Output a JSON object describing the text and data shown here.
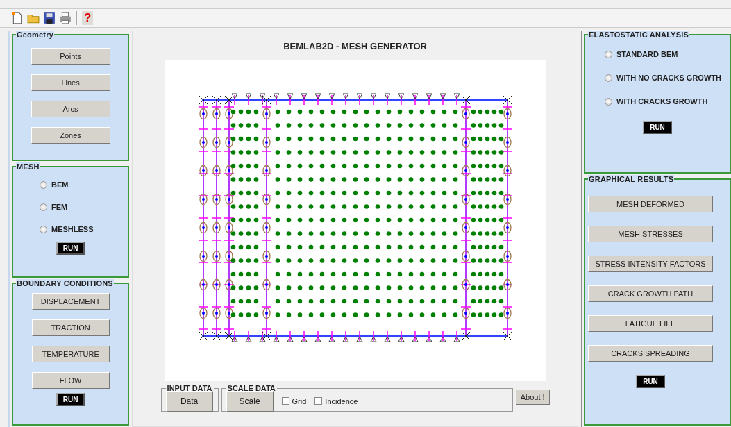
{
  "toolbar": {
    "help_label": "?"
  },
  "geometry": {
    "title": "Geometry",
    "buttons": [
      "Points",
      "Lines",
      "Arcs",
      "Zones"
    ]
  },
  "mesh": {
    "title": "MESH",
    "options": [
      {
        "label": "BEM",
        "selected": false
      },
      {
        "label": "FEM",
        "selected": false
      },
      {
        "label": "MESHLESS",
        "selected": false
      }
    ],
    "run": "RUN"
  },
  "boundary_conditions": {
    "title": "BOUNDARY CONDITIONS",
    "buttons": [
      "DISPLACEMENT",
      "TRACTION",
      "TEMPERATURE",
      "FLOW"
    ],
    "run": "RUN"
  },
  "center": {
    "title": "BEMLAB2D - MESH GENERATOR"
  },
  "input_data": {
    "title": "INPUT DATA",
    "button": "Data"
  },
  "scale_data": {
    "title": "SCALE DATA",
    "button": "Scale",
    "checkboxes": [
      {
        "label": "Grid",
        "checked": false
      },
      {
        "label": "Incidence",
        "checked": false
      }
    ]
  },
  "about": "About !",
  "elastostatic": {
    "title": "ELASTOSTATIC ANALYSIS",
    "options": [
      {
        "label": "STANDARD BEM",
        "selected": false
      },
      {
        "label": "WITH NO CRACKS GROWTH",
        "selected": false
      },
      {
        "label": "WITH CRACKS GROWTH",
        "selected": false
      }
    ],
    "run": "RUN"
  },
  "graphical_results": {
    "title": "GRAPHICAL RESULTS",
    "buttons": [
      "MESH DEFORMED",
      "MESH STRESSES",
      "STRESS INTENSITY FACTORS",
      "CRACK GROWTH PATH",
      "FATIGUE LIFE",
      "CRACKS SPREADING"
    ],
    "run": "RUN"
  }
}
